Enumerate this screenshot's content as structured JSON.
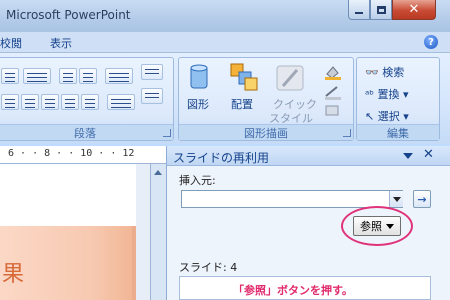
{
  "window": {
    "title": "Microsoft PowerPoint"
  },
  "menu": {
    "items": [
      "校閲",
      "表示"
    ]
  },
  "ribbon": {
    "groups": {
      "paragraph": {
        "label": "段落"
      },
      "drawing": {
        "label": "図形描画",
        "shape_label": "図形",
        "arrange_label": "配置",
        "quick_style_line1": "クイック",
        "quick_style_line2": "スタイル"
      },
      "editing": {
        "label": "編集",
        "find_label": "検索",
        "replace_label": "置換",
        "select_label": "選択"
      }
    }
  },
  "ruler": {
    "text": "6 · · 8 · · 10 · · 12"
  },
  "slide": {
    "text": "果"
  },
  "task_pane": {
    "title": "スライドの再利用",
    "insert_from_label": "挿入元:",
    "source_value": "",
    "browse_label": "参照",
    "go_symbol": "→",
    "slide_count_label": "スライド: 4",
    "annotation": "「参照」ボタンを押す。"
  },
  "colors": {
    "highlight": "#e0327a",
    "annotation": "#e02a6b"
  }
}
